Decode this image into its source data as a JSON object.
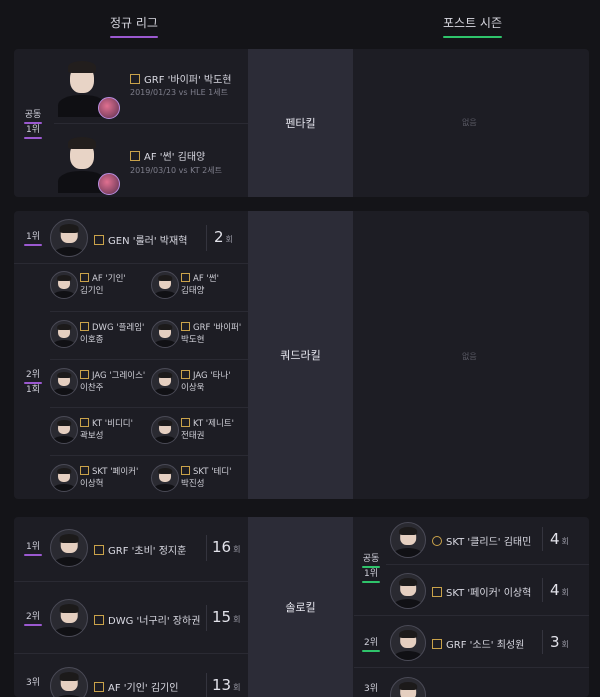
{
  "tabs": [
    {
      "label": "정규 리그",
      "accent": "#9b59d0"
    },
    {
      "label": "포스트 시즌",
      "accent": "#2fc46b"
    }
  ],
  "colors": {
    "purple": "#9b59d0",
    "green": "#2fc46b",
    "gold": "#c9a24a"
  },
  "penta": {
    "title": "펜타킬",
    "rank": "공동",
    "rank_sub": "1위",
    "players": [
      {
        "name": "GRF '바이퍼' 박도현",
        "date": "2019/01/23 vs HLE 1세트"
      },
      {
        "name": "AF '썬' 김태양",
        "date": "2019/03/10 vs KT 2세트"
      }
    ],
    "post": "없음"
  },
  "quadra": {
    "title": "쿼드라킬",
    "first": {
      "rank": "1위",
      "name": "GEN '룰러' 박재혁",
      "count": "2",
      "unit": "회"
    },
    "second_rank": "2위",
    "second_count": "1회",
    "pairs": [
      [
        {
          "team": "AF '기인'",
          "real": "김기인"
        },
        {
          "team": "AF '썬'",
          "real": "김태양"
        }
      ],
      [
        {
          "team": "DWG '플레임'",
          "real": "이호종"
        },
        {
          "team": "GRF '바이퍼'",
          "real": "박도현"
        }
      ],
      [
        {
          "team": "JAG '그레이스'",
          "real": "이찬주"
        },
        {
          "team": "JAG '타나'",
          "real": "이상욱"
        }
      ],
      [
        {
          "team": "KT '비디디'",
          "real": "곽보성"
        },
        {
          "team": "KT '제니트'",
          "real": "전태권"
        }
      ],
      [
        {
          "team": "SKT '페이커'",
          "real": "이상혁"
        },
        {
          "team": "SKT '테디'",
          "real": "박진성"
        }
      ]
    ],
    "post": "없음"
  },
  "solo": {
    "title": "솔로킬",
    "regular": [
      {
        "rank": "1위",
        "name": "GRF '초비' 정지훈",
        "count": "16",
        "unit": "회"
      },
      {
        "rank": "2위",
        "name": "DWG '너구리' 장하권",
        "count": "15",
        "unit": "회"
      },
      {
        "rank": "3위",
        "name": "AF '기인' 김기인",
        "count": "13",
        "unit": "회"
      }
    ],
    "post_rank": "공동",
    "post_rank_sub": "1위",
    "post": [
      {
        "name": "SKT '클리드' 김태민",
        "count": "4",
        "unit": "회"
      },
      {
        "name": "SKT '페이커' 이상혁",
        "count": "4",
        "unit": "회"
      },
      {
        "rank": "2위",
        "name": "GRF '소드' 최성원",
        "count": "3",
        "unit": "회"
      },
      {
        "rank": "3위"
      }
    ]
  }
}
